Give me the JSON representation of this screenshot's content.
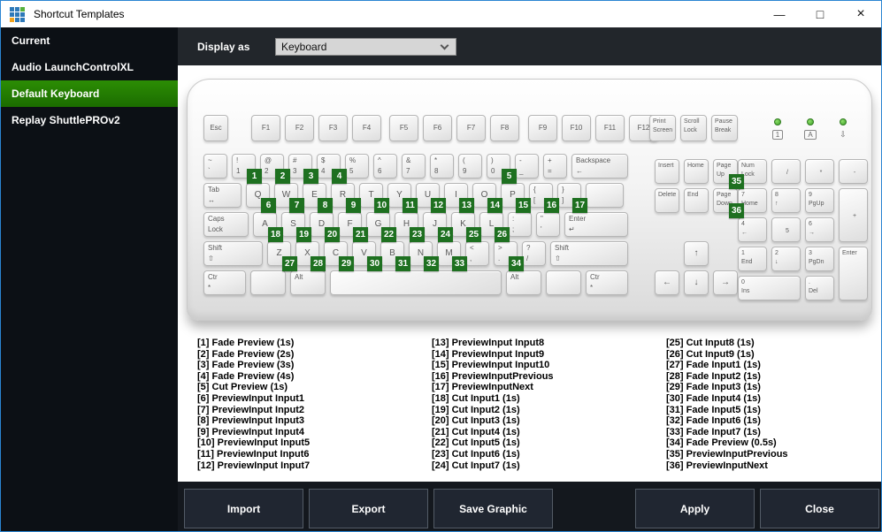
{
  "window": {
    "title": "Shortcut Templates",
    "controls": {
      "minimize": "—",
      "maximize": "□",
      "close": "×"
    },
    "logo_cells": [
      "#2e79b9",
      "#2e79b9",
      "#56b13c",
      "#2e79b9",
      "#2e79b9",
      "#2e79b9",
      "#f2a31d",
      "#2e79b9",
      "#2e79b9"
    ]
  },
  "sidebar": {
    "items": [
      {
        "label": "Current",
        "selected": false
      },
      {
        "label": "Audio LaunchControlXL",
        "selected": false
      },
      {
        "label": "Default Keyboard",
        "selected": true
      },
      {
        "label": "Replay ShuttlePROv2",
        "selected": false
      }
    ]
  },
  "topbar": {
    "label": "Display as",
    "value": "Keyboard"
  },
  "keyboard": {
    "badge_color": "#1e7020",
    "esc": "Esc",
    "f_groups": [
      [
        "F1",
        "F2",
        "F3",
        "F4"
      ],
      [
        "F5",
        "F6",
        "F7",
        "F8"
      ],
      [
        "F9",
        "F10",
        "F11",
        "F12"
      ]
    ],
    "system_keys": [
      {
        "lines": [
          "Print",
          "Screen"
        ]
      },
      {
        "lines": [
          "Scroll",
          "Lock"
        ]
      },
      {
        "lines": [
          "Pause",
          "Break"
        ]
      }
    ],
    "leds": [
      {
        "label": "1",
        "boxed": true
      },
      {
        "label": "A",
        "boxed": true
      },
      {
        "label": "⇩",
        "boxed": false
      }
    ],
    "main_rows": [
      [
        {
          "lines": [
            "~",
            "`"
          ]
        },
        {
          "lines": [
            "!",
            "1"
          ],
          "badge": "1"
        },
        {
          "lines": [
            "@",
            "2"
          ],
          "badge": "2"
        },
        {
          "lines": [
            "#",
            "3"
          ],
          "badge": "3"
        },
        {
          "lines": [
            "$",
            "4"
          ],
          "badge": "4"
        },
        {
          "lines": [
            "%",
            "5"
          ]
        },
        {
          "lines": [
            "^",
            "6"
          ]
        },
        {
          "lines": [
            "&",
            "7"
          ]
        },
        {
          "lines": [
            "*",
            "8"
          ]
        },
        {
          "lines": [
            "(",
            "9"
          ]
        },
        {
          "lines": [
            ")",
            "0"
          ],
          "badge": "5"
        },
        {
          "lines": [
            "-",
            "_"
          ]
        },
        {
          "lines": [
            "+",
            "="
          ]
        },
        {
          "lines": [
            "Backspace",
            "←"
          ],
          "w": 64
        }
      ],
      [
        {
          "lines": [
            "Tab",
            "↔"
          ],
          "w": 43
        },
        {
          "lines": [
            "Q"
          ],
          "badge": "6"
        },
        {
          "lines": [
            "W"
          ],
          "badge": "7"
        },
        {
          "lines": [
            "E"
          ],
          "badge": "8"
        },
        {
          "lines": [
            "R"
          ],
          "badge": "9"
        },
        {
          "lines": [
            "T"
          ],
          "badge": "10"
        },
        {
          "lines": [
            "Y"
          ],
          "badge": "11"
        },
        {
          "lines": [
            "U"
          ],
          "badge": "12"
        },
        {
          "lines": [
            "I"
          ],
          "badge": "13"
        },
        {
          "lines": [
            "O"
          ],
          "badge": "14"
        },
        {
          "lines": [
            "P"
          ],
          "badge": "15"
        },
        {
          "lines": [
            "{",
            "["
          ],
          "badge": "16"
        },
        {
          "lines": [
            "}",
            "]"
          ],
          "badge": "17"
        },
        {
          "lines": [
            ""
          ],
          "w": 43
        }
      ],
      [
        {
          "lines": [
            "Caps",
            "Lock"
          ],
          "w": 51
        },
        {
          "lines": [
            "A"
          ],
          "badge": "18"
        },
        {
          "lines": [
            "S"
          ],
          "badge": "19"
        },
        {
          "lines": [
            "D"
          ],
          "badge": "20"
        },
        {
          "lines": [
            "F"
          ],
          "badge": "21"
        },
        {
          "lines": [
            "G"
          ],
          "badge": "22"
        },
        {
          "lines": [
            "H"
          ],
          "badge": "23"
        },
        {
          "lines": [
            "J"
          ],
          "badge": "24"
        },
        {
          "lines": [
            "K"
          ],
          "badge": "25"
        },
        {
          "lines": [
            "L"
          ],
          "badge": "26"
        },
        {
          "lines": [
            ":",
            ";"
          ]
        },
        {
          "lines": [
            "\"",
            "'"
          ]
        },
        {
          "lines": [
            "Enter",
            "↵"
          ],
          "w": 72
        }
      ],
      [
        {
          "lines": [
            "Shift",
            "⇧"
          ],
          "w": 67
        },
        {
          "lines": [
            "Z"
          ],
          "badge": "27"
        },
        {
          "lines": [
            "X"
          ],
          "badge": "28"
        },
        {
          "lines": [
            "C"
          ],
          "badge": "29"
        },
        {
          "lines": [
            "V"
          ],
          "badge": "30"
        },
        {
          "lines": [
            "B"
          ],
          "badge": "31"
        },
        {
          "lines": [
            "N"
          ],
          "badge": "32"
        },
        {
          "lines": [
            "M"
          ],
          "badge": "33"
        },
        {
          "lines": [
            "<",
            ","
          ]
        },
        {
          "lines": [
            ">",
            "."
          ],
          "badge": "34"
        },
        {
          "lines": [
            "?",
            "/"
          ]
        },
        {
          "lines": [
            "Shift",
            "⇧"
          ],
          "w": 88
        }
      ],
      [
        {
          "lines": [
            "Ctr",
            "*"
          ],
          "w": 48
        },
        {
          "lines": [
            ""
          ],
          "w": 40
        },
        {
          "lines": [
            "Alt"
          ],
          "w": 40
        },
        {
          "lines": [
            ""
          ],
          "w": 194
        },
        {
          "lines": [
            "Alt"
          ],
          "w": 40
        },
        {
          "lines": [
            ""
          ],
          "w": 40
        },
        {
          "lines": [
            "Ctr",
            "*"
          ],
          "w": 48
        }
      ]
    ],
    "nav_keys": [
      {
        "lines": [
          "Insert"
        ]
      },
      {
        "lines": [
          "Home"
        ]
      },
      {
        "lines": [
          "Page",
          "Up"
        ],
        "badge": "35"
      },
      {
        "lines": [
          "Delete"
        ]
      },
      {
        "lines": [
          "End"
        ]
      },
      {
        "lines": [
          "Page",
          "Down"
        ],
        "badge": "36"
      }
    ],
    "arrow_keys": [
      "↑",
      "←",
      "↓",
      "→"
    ],
    "numpad": [
      {
        "c": 0,
        "r": 0,
        "lines": [
          "Num",
          "Lock"
        ]
      },
      {
        "c": 1,
        "r": 0,
        "lines": [
          "/"
        ]
      },
      {
        "c": 2,
        "r": 0,
        "lines": [
          "*"
        ]
      },
      {
        "c": 3,
        "r": 0,
        "lines": [
          "-"
        ]
      },
      {
        "c": 0,
        "r": 1,
        "lines": [
          "7",
          "Home"
        ]
      },
      {
        "c": 1,
        "r": 1,
        "lines": [
          "8",
          "↑"
        ]
      },
      {
        "c": 2,
        "r": 1,
        "lines": [
          "9",
          "PgUp"
        ]
      },
      {
        "c": 3,
        "r": 1,
        "h": 2,
        "lines": [
          "+"
        ]
      },
      {
        "c": 0,
        "r": 2,
        "lines": [
          "4",
          "←"
        ]
      },
      {
        "c": 1,
        "r": 2,
        "lines": [
          "5"
        ]
      },
      {
        "c": 2,
        "r": 2,
        "lines": [
          "6",
          "→"
        ]
      },
      {
        "c": 0,
        "r": 3,
        "lines": [
          "1",
          "End"
        ]
      },
      {
        "c": 1,
        "r": 3,
        "lines": [
          "2",
          "↓"
        ]
      },
      {
        "c": 2,
        "r": 3,
        "lines": [
          "3",
          "PgDn"
        ]
      },
      {
        "c": 3,
        "r": 3,
        "h": 2,
        "lines": [
          "Enter"
        ]
      },
      {
        "c": 0,
        "r": 4,
        "w": 2,
        "lines": [
          "0",
          "Ins"
        ]
      },
      {
        "c": 2,
        "r": 4,
        "lines": [
          ".",
          "Del"
        ]
      }
    ]
  },
  "shortcuts": {
    "columns": [
      [
        "[1] Fade Preview (1s)",
        "[2] Fade Preview (2s)",
        "[3] Fade Preview (3s)",
        "[4] Fade Preview (4s)",
        "[5] Cut Preview (1s)",
        "[6] PreviewInput Input1",
        "[7] PreviewInput Input2",
        "[8] PreviewInput Input3",
        "[9] PreviewInput Input4",
        "[10] PreviewInput Input5",
        "[11] PreviewInput Input6",
        "[12] PreviewInput Input7"
      ],
      [
        "[13] PreviewInput Input8",
        "[14] PreviewInput Input9",
        "[15] PreviewInput Input10",
        "[16] PreviewInputPrevious",
        "[17] PreviewInputNext",
        "[18] Cut Input1 (1s)",
        "[19] Cut Input2 (1s)",
        "[20] Cut Input3 (1s)",
        "[21] Cut Input4 (1s)",
        "[22] Cut Input5 (1s)",
        "[23] Cut Input6 (1s)",
        "[24] Cut Input7 (1s)"
      ],
      [
        "[25] Cut Input8 (1s)",
        "[26] Cut Input9 (1s)",
        "[27] Fade Input1 (1s)",
        "[28] Fade Input2 (1s)",
        "[29] Fade Input3 (1s)",
        "[30] Fade Input4 (1s)",
        "[31] Fade Input5 (1s)",
        "[32] Fade Input6 (1s)",
        "[33] Fade Input7 (1s)",
        "[34] Fade Preview (0.5s)",
        "[35] PreviewInputPrevious",
        "[36] PreviewInputNext"
      ]
    ]
  },
  "buttons": [
    {
      "label": "Import",
      "name": "import-button"
    },
    {
      "label": "Export",
      "name": "export-button"
    },
    {
      "label": "Save Graphic",
      "name": "save-graphic-button"
    },
    {
      "label": "Apply",
      "name": "apply-button"
    },
    {
      "label": "Close",
      "name": "close-button"
    }
  ]
}
